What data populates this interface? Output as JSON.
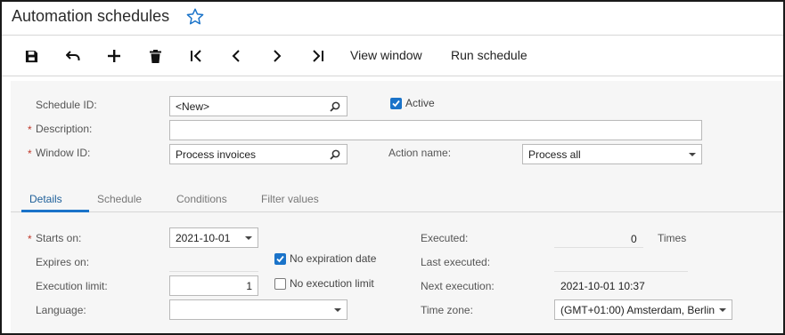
{
  "header": {
    "title": "Automation schedules",
    "favorite_icon": "star-icon"
  },
  "toolbar": {
    "icons": [
      "save-icon",
      "undo-icon",
      "add-icon",
      "delete-icon",
      "first-record-icon",
      "previous-record-icon",
      "next-record-icon",
      "last-record-icon"
    ],
    "view_window_label": "View window",
    "run_schedule_label": "Run schedule"
  },
  "form": {
    "schedule_id": {
      "label": "Schedule ID:",
      "value": "<New>"
    },
    "active": {
      "label": "Active",
      "checked": true
    },
    "description": {
      "label": "Description:",
      "value": ""
    },
    "window_id": {
      "label": "Window ID:",
      "value": "Process invoices"
    },
    "action_name": {
      "label": "Action name:",
      "value": "Process all"
    },
    "required_mark": "*"
  },
  "tabs": [
    {
      "label": "Details",
      "active": true
    },
    {
      "label": "Schedule",
      "active": false
    },
    {
      "label": "Conditions",
      "active": false
    },
    {
      "label": "Filter values",
      "active": false
    }
  ],
  "details": {
    "starts_on": {
      "label": "Starts on:",
      "value": "2021-10-01"
    },
    "expires_on": {
      "label": "Expires on:",
      "value": ""
    },
    "no_expiration": {
      "label": "No expiration date",
      "checked": true
    },
    "execution_limit": {
      "label": "Execution limit:",
      "value": "1"
    },
    "no_execution_limit": {
      "label": "No execution limit",
      "checked": false
    },
    "language": {
      "label": "Language:",
      "value": ""
    },
    "executed": {
      "label": "Executed:",
      "value": "0",
      "unit": "Times"
    },
    "last_executed": {
      "label": "Last executed:",
      "value": ""
    },
    "next_execution": {
      "label": "Next execution:",
      "value": "2021-10-01 10:37"
    },
    "time_zone": {
      "label": "Time zone:",
      "value": "(GMT+01:00) Amsterdam, Berlin"
    }
  },
  "colors": {
    "accent": "#1a73c9",
    "required": "#c0392b",
    "panel": "#f6f6f6"
  }
}
